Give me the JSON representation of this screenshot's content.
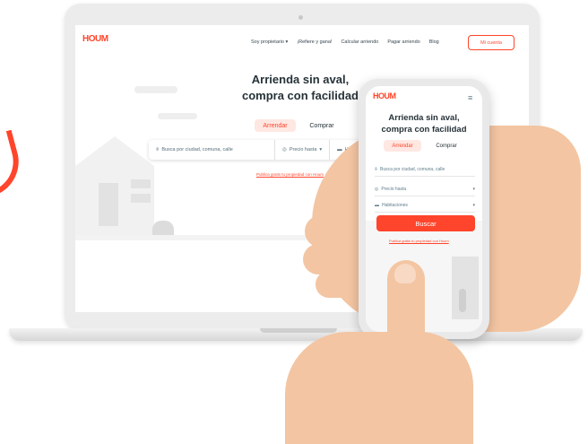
{
  "desktop": {
    "logo": "HOUM",
    "nav": {
      "owner": "Soy propietario",
      "refer": "¡Refiere y gana!",
      "calc": "Calcular arriendo",
      "pay": "Pagar arriendo",
      "blog": "Blog"
    },
    "account_button": "Mi cuenta",
    "hero_line1": "Arrienda sin aval,",
    "hero_line2": "compra con facilidad",
    "tab_rent": "Arrendar",
    "tab_buy": "Comprar",
    "search_placeholder": "Busca por ciudad, comuna, calle",
    "price_filter": "Precio hasta",
    "rooms_filter_truncated": "H",
    "publish_link": "Publica gratis tu propiedad con Houm"
  },
  "mobile": {
    "logo": "HOUM",
    "hero_line1": "Arrienda sin aval,",
    "hero_line2": "compra con facilidad",
    "tab_rent": "Arrendar",
    "tab_buy": "Comprar",
    "search_placeholder": "Busca por ciudad, comuna, calle",
    "price_filter": "Precio hasta",
    "rooms_filter": "Habitaciones",
    "search_button": "Buscar",
    "publish_link": "Publica gratis tu propiedad con Houm"
  },
  "colors": {
    "brand": "#ff452b",
    "text": "#263238",
    "tab_active_bg": "#ffe7e2"
  },
  "icons": [
    "location-icon",
    "price-icon",
    "bed-icon",
    "chevron-down-icon",
    "hamburger-menu-icon"
  ]
}
